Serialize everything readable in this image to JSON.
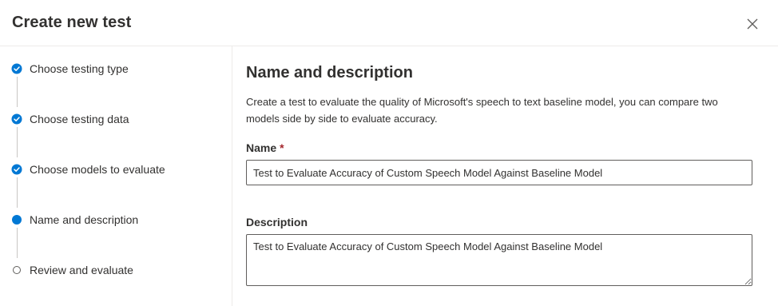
{
  "dialog": {
    "title": "Create new test",
    "close_icon": "close-icon"
  },
  "steps": [
    {
      "label": "Choose testing type",
      "state": "completed",
      "icon": "checkmark-circle-icon"
    },
    {
      "label": "Choose testing data",
      "state": "completed",
      "icon": "checkmark-circle-icon"
    },
    {
      "label": "Choose models to evaluate",
      "state": "completed",
      "icon": "checkmark-circle-icon"
    },
    {
      "label": "Name and description",
      "state": "current",
      "icon": "current-step-dot-icon"
    },
    {
      "label": "Review and evaluate",
      "state": "pending",
      "icon": "pending-step-circle-icon"
    }
  ],
  "main": {
    "section_title": "Name and description",
    "description": "Create a test to evaluate the quality of Microsoft's speech to text baseline model, you can compare two models side by side to evaluate accuracy.",
    "name_field": {
      "label": "Name",
      "required_marker": "*",
      "value": "Test to Evaluate Accuracy of Custom Speech Model Against Baseline Model"
    },
    "description_field": {
      "label": "Description",
      "value": "Test to Evaluate Accuracy of Custom Speech Model Against Baseline Model"
    }
  },
  "colors": {
    "accent": "#0078d4",
    "required": "#a4262c",
    "text": "#323130",
    "border": "#605e5c",
    "divider": "#edebe9"
  }
}
